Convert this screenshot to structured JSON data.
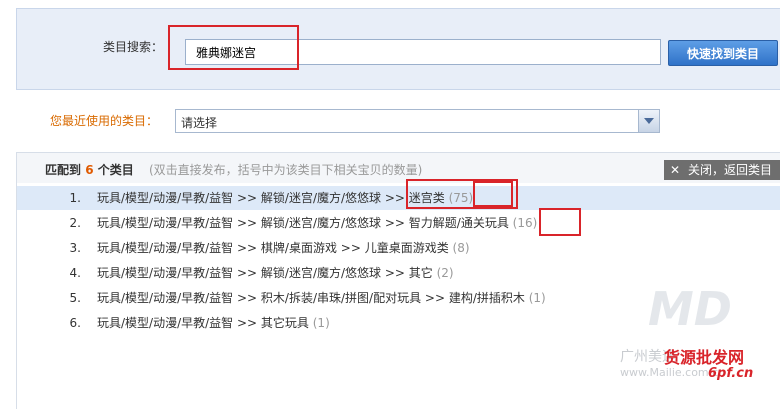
{
  "search": {
    "label": "类目搜索：",
    "value": "雅典娜迷宫",
    "button_label": "快速找到类目"
  },
  "recent": {
    "label": "您最近使用的类目：",
    "selected": "请选择"
  },
  "results": {
    "title_prefix": "匹配到",
    "count": "6",
    "title_suffix": "个类目",
    "hint": "(双击直接发布，括号中为该类目下相关宝贝的数量)",
    "close_label": "关闭，返回类目",
    "items": [
      {
        "num": "1.",
        "path": "玩具/模型/动漫/早教/益智 >> 解锁/迷宫/魔方/悠悠球 >> 迷宫类",
        "count": "(75)"
      },
      {
        "num": "2.",
        "path": "玩具/模型/动漫/早教/益智 >> 解锁/迷宫/魔方/悠悠球 >> 智力解题/通关玩具",
        "count": "(16)"
      },
      {
        "num": "3.",
        "path": "玩具/模型/动漫/早教/益智 >> 棋牌/桌面游戏 >> 儿童桌面游戏类",
        "count": "(8)"
      },
      {
        "num": "4.",
        "path": "玩具/模型/动漫/早教/益智 >> 解锁/迷宫/魔方/悠悠球 >> 其它",
        "count": "(2)"
      },
      {
        "num": "5.",
        "path": "玩具/模型/动漫/早教/益智 >> 积木/拆装/串珠/拼图/配对玩具 >> 建构/拼插积木",
        "count": "(1)"
      },
      {
        "num": "6.",
        "path": "玩具/模型/动漫/早教/益智 >> 其它玩具",
        "count": "(1)"
      }
    ]
  },
  "watermark": {
    "logo_text": "MD",
    "cn_text": "广州美迪",
    "red_text": "货源批发网",
    "url": "www.Mailie.com.cn",
    "url2": "6pf.cn"
  }
}
